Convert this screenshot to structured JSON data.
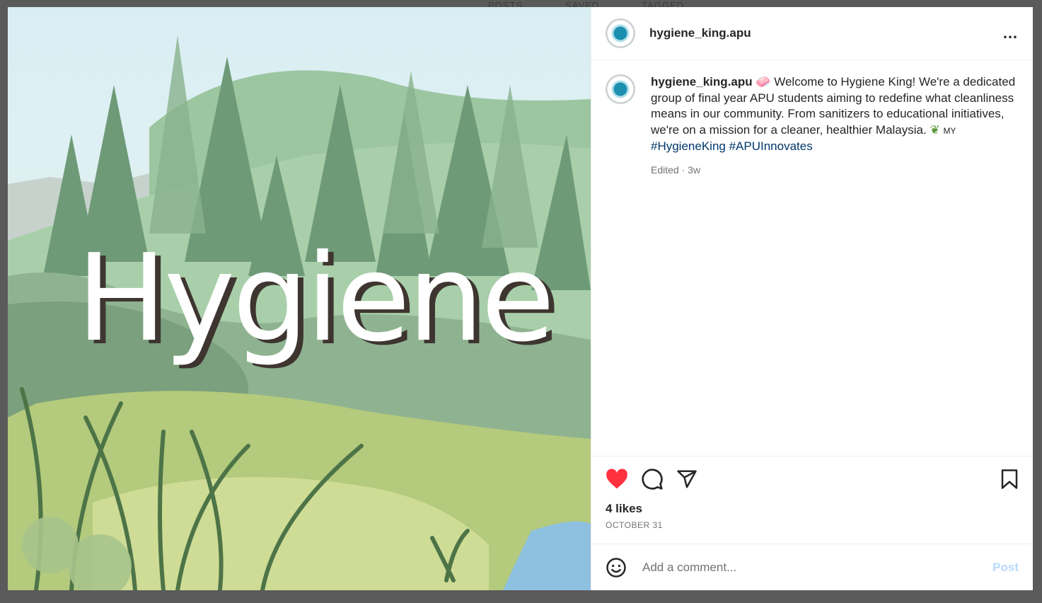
{
  "background_tabs": [
    "POSTS",
    "SAVED",
    "TAGGED"
  ],
  "post": {
    "image_text": "Hygiene",
    "username": "hygiene_king.apu",
    "more_icon": "…",
    "caption_username": "hygiene_king.apu",
    "caption_text": "Welcome to Hygiene King! We're a dedicated group of final year APU students aiming to redefine what cleanliness means in our community. From sanitizers to educational initiatives, we're on a mission for a cleaner, healthier Malaysia.",
    "flag_text": "MY",
    "hashtags": [
      "#HygieneKing",
      "#APUInnovates"
    ],
    "edited": "Edited",
    "time_ago": "3w",
    "likes": "4 likes",
    "date": "OCTOBER 31",
    "comment_placeholder": "Add a comment...",
    "post_button": "Post"
  },
  "icons": {
    "like": "heart-icon",
    "comment": "comment-icon",
    "share": "share-icon",
    "save": "bookmark-icon",
    "emoji": "emoji-icon"
  },
  "colors": {
    "like": "#ff3040",
    "hashtag": "#00376b",
    "post_button": "#b7dafc"
  }
}
